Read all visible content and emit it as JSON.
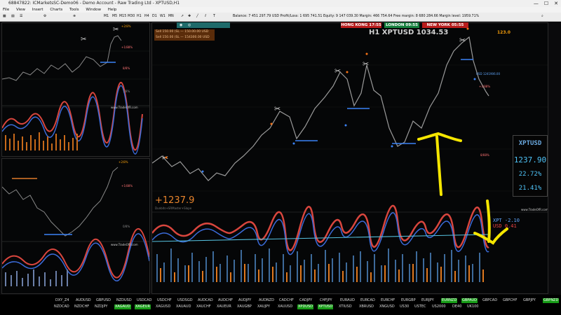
{
  "window": {
    "title": "68847822: ICMarketsSC-Demo06 - Demo Account - Raw Trading Ltd - XPTUSD,H1",
    "min": "—",
    "max": "☐",
    "close": "✕"
  },
  "menu": [
    "File",
    "View",
    "Insert",
    "Charts",
    "Tools",
    "Window",
    "Help"
  ],
  "toolbar": {
    "timeframes": [
      "M1",
      "M5",
      "M15",
      "M30",
      "H1",
      "H4",
      "D1",
      "W1",
      "MN"
    ],
    "account": "Balance: 7 451 297.79 USD  Profit/Loss: 1 695 741.51  Equity: 9 147 039.30  Margin: 466 754.64  Free margin: 8 680 284.66  Margin level: 1959.71%"
  },
  "clocks": {
    "hk": "HONG KONG 17:55",
    "london": "LONDON  09:55",
    "ny": "NEW YORK  05:55"
  },
  "main_chart": {
    "title": "H1 XPTUSD 1034.53",
    "price_display": "+1237.9",
    "orange_label": "123.0",
    "current_label": "USD 1241906.00",
    "pct_plus": "+1/88%",
    "pct_minus": "8/88%",
    "watermark": "www.TradeOfR.com",
    "indicator_label": "Dunbits+SRMaster+Slope"
  },
  "orders": [
    "Sell 150.00 (SL — 150.00.00 USD",
    "Sell 150.00 (SL — 154300.00 USD"
  ],
  "sidebox": {
    "symbol": "XPTUSD",
    "price": "1237.90",
    "pct1": "22.72%",
    "pct2": "21.41%"
  },
  "osc": {
    "xpt": "XPT -2.10",
    "usd": "USD  0.41"
  },
  "left_top": {
    "pct_plus": "+2/8%",
    "pct1": "+1/88%",
    "pct2": "8/8%",
    "pct3": "7/8%",
    "wm": "www.TradeOfR.com"
  },
  "left_bottom": {
    "pct_plus": "+2/8%",
    "pct1": "+1/88%",
    "pct2": "0/8%",
    "wm": "www.TradeOfR.com"
  },
  "symbols_row1": [
    {
      "t": "DXY_Z4",
      "h": false
    },
    {
      "t": "AUDUSD",
      "h": false
    },
    {
      "t": "GBPUSD",
      "h": false
    },
    {
      "t": "NZDUSD",
      "h": false
    },
    {
      "t": "USDCAD",
      "h": false
    },
    {
      "t": "USDCHF",
      "h": false
    },
    {
      "t": "USDSGD",
      "h": false
    },
    {
      "t": "AUDCAD",
      "h": false
    },
    {
      "t": "AUDCHF",
      "h": false
    },
    {
      "t": "AUDJPY",
      "h": false
    },
    {
      "t": "AUDNZD",
      "h": false
    },
    {
      "t": "CADCHF",
      "h": false
    },
    {
      "t": "CADJPY",
      "h": false
    },
    {
      "t": "CHFJPY",
      "h": false
    },
    {
      "t": "EURAUD",
      "h": false
    },
    {
      "t": "EURCAD",
      "h": false
    },
    {
      "t": "EURCHF",
      "h": false
    },
    {
      "t": "EURGBP",
      "h": false
    },
    {
      "t": "EURJPY",
      "h": false
    },
    {
      "t": "EURNZD",
      "h": true
    },
    {
      "t": "GBPAUD",
      "h": true
    },
    {
      "t": "GBPCAD",
      "h": false
    },
    {
      "t": "GBPCHF",
      "h": false
    },
    {
      "t": "GBPJPY",
      "h": false
    },
    {
      "t": "GBPNZD",
      "h": true
    }
  ],
  "symbols_row2": [
    {
      "t": "NZDCAD",
      "h": false
    },
    {
      "t": "NZDCHF",
      "h": false
    },
    {
      "t": "NZDJPY",
      "h": false
    },
    {
      "t": "XAGAUD",
      "h": true
    },
    {
      "t": "XAGEUR",
      "h": true
    },
    {
      "t": "XAGUSD",
      "h": false
    },
    {
      "t": "XAUAUD",
      "h": false
    },
    {
      "t": "XAUCHF",
      "h": false
    },
    {
      "t": "XAUEUR",
      "h": false
    },
    {
      "t": "XAUGBP",
      "h": false
    },
    {
      "t": "XAUJPY",
      "h": false
    },
    {
      "t": "XAUUSD",
      "h": false
    },
    {
      "t": "XPDUSD",
      "h": true
    },
    {
      "t": "XPTUSD",
      "h": true
    },
    {
      "t": "XTIUSD",
      "h": false
    },
    {
      "t": "XBRUSD",
      "h": false
    },
    {
      "t": "XNGUSD",
      "h": false
    },
    {
      "t": "US30",
      "h": false
    },
    {
      "t": "USTEC",
      "h": false
    },
    {
      "t": "US2000",
      "h": false
    },
    {
      "t": "DE40",
      "h": false
    },
    {
      "t": "UK100",
      "h": false
    }
  ]
}
